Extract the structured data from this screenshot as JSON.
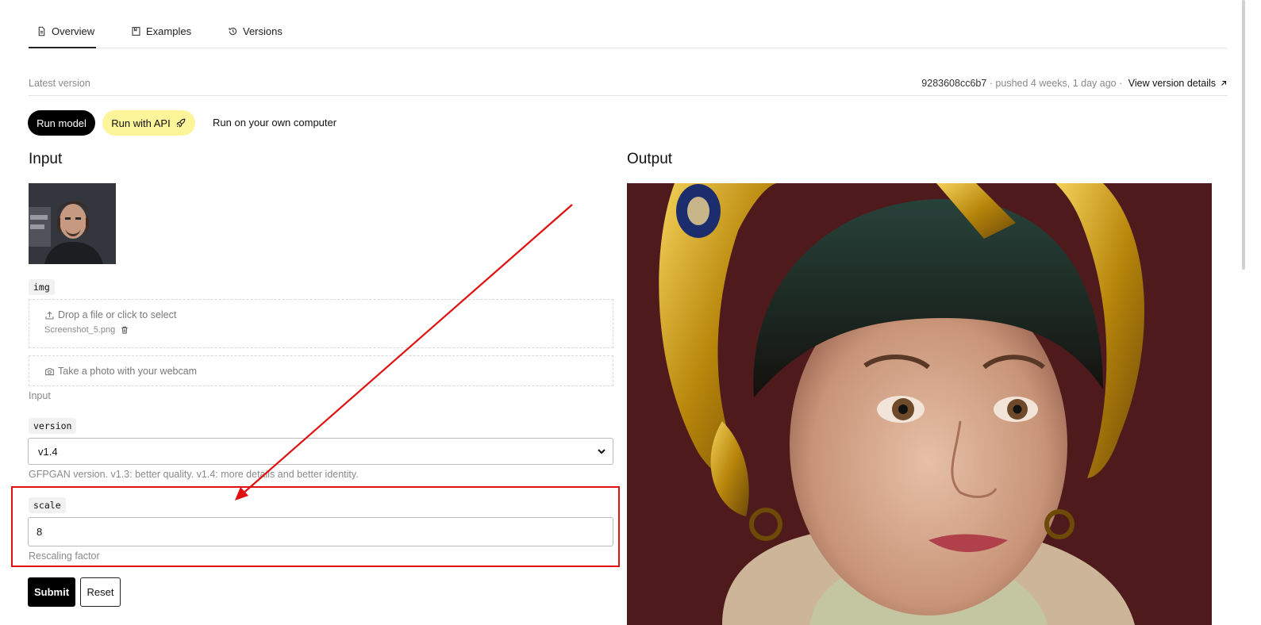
{
  "tabs": [
    {
      "label": "Overview",
      "icon": "document-icon",
      "active": true
    },
    {
      "label": "Examples",
      "icon": "bookmark-icon",
      "active": false
    },
    {
      "label": "Versions",
      "icon": "history-icon",
      "active": false
    }
  ],
  "version_row": {
    "label": "Latest version",
    "hash": "9283608cc6b7",
    "pushed": " · pushed 4 weeks, 1 day ago · ",
    "link": "View version details",
    "link_icon": "arrow-up-right-icon"
  },
  "run_buttons": {
    "run_model": "Run model",
    "run_api": "Run with API",
    "run_api_icon": "rocket-icon",
    "run_own": "Run on your own computer"
  },
  "input": {
    "heading": "Input",
    "img_badge": "img",
    "dropzone_text": "Drop a file or click to select",
    "dropzone_icon": "upload-icon",
    "file_name": "Screenshot_5.png",
    "file_remove_icon": "trash-icon",
    "webcam_text": "Take a photo with your webcam",
    "webcam_icon": "camera-icon",
    "img_hint": "Input",
    "version_badge": "version",
    "version_value": "v1.4",
    "version_hint": "GFPGAN version. v1.3: better quality. v1.4: more details and better identity.",
    "scale_badge": "scale",
    "scale_value": "8",
    "scale_hint": "Rescaling factor",
    "submit": "Submit",
    "reset": "Reset"
  },
  "output": {
    "heading": "Output"
  },
  "colors": {
    "accent_yellow": "#fdf59a",
    "annotation_red": "#e01010",
    "primary_black": "#000000"
  }
}
